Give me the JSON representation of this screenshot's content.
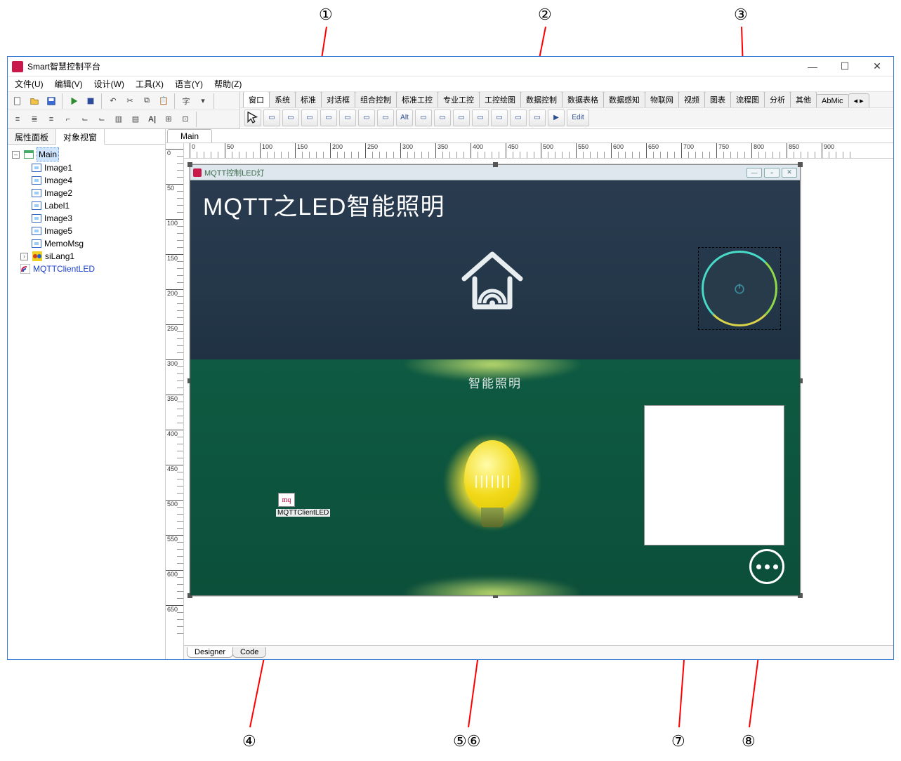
{
  "window": {
    "title": "Smart智慧控制平台",
    "min": "—",
    "max": "☐",
    "close": "✕"
  },
  "menu": [
    "文件(U)",
    "编辑(V)",
    "设计(W)",
    "工具(X)",
    "语言(Y)",
    "帮助(Z)"
  ],
  "palette_tabs": [
    "窗口",
    "系统",
    "标准",
    "对话框",
    "组合控制",
    "标准工控",
    "专业工控",
    "工控绘图",
    "数据控制",
    "数据表格",
    "数据感知",
    "物联网",
    "视频",
    "图表",
    "流程图",
    "分析",
    "其他",
    "AbMic"
  ],
  "palette_active": "窗口",
  "left_tabs": {
    "prop": "属性面板",
    "obj": "对象视窗"
  },
  "tree": {
    "root": "Main",
    "children": [
      "Image1",
      "Image4",
      "Image2",
      "Label1",
      "Image3",
      "Image5",
      "MemoMsg"
    ],
    "siblings": [
      "siLang1",
      "MQTTClientLED"
    ]
  },
  "doc_tab": "Main",
  "hruler_ticks": [
    0,
    50,
    100,
    150,
    200,
    250,
    300,
    350,
    400,
    450,
    500,
    550,
    600,
    650,
    700,
    750,
    800,
    850,
    900
  ],
  "vruler_ticks": [
    0,
    50,
    100,
    150,
    200,
    250,
    300,
    350,
    400,
    450,
    500,
    550,
    600,
    650
  ],
  "form": {
    "title": "MQTT控制LED灯",
    "hero_title_a": "MQTT之",
    "hero_title_b": "LED",
    "hero_title_c": "智能照明",
    "label_smart": "智能照明",
    "mqtt_icon_text": "mq",
    "mqtt_label": "MQTTClientLED"
  },
  "bottom_tabs": {
    "designer": "Designer",
    "code": "Code"
  },
  "callouts": [
    "①",
    "②",
    "③",
    "④",
    "⑤⑥",
    "⑦",
    "⑧"
  ],
  "palette_btns": [
    "▭",
    "▭",
    "▭",
    "▭",
    "▭",
    "▭",
    "▭",
    "Alt",
    "▭",
    "▭",
    "▭",
    "▭",
    "▭",
    "▭",
    "▭",
    "▶",
    "Edit"
  ]
}
